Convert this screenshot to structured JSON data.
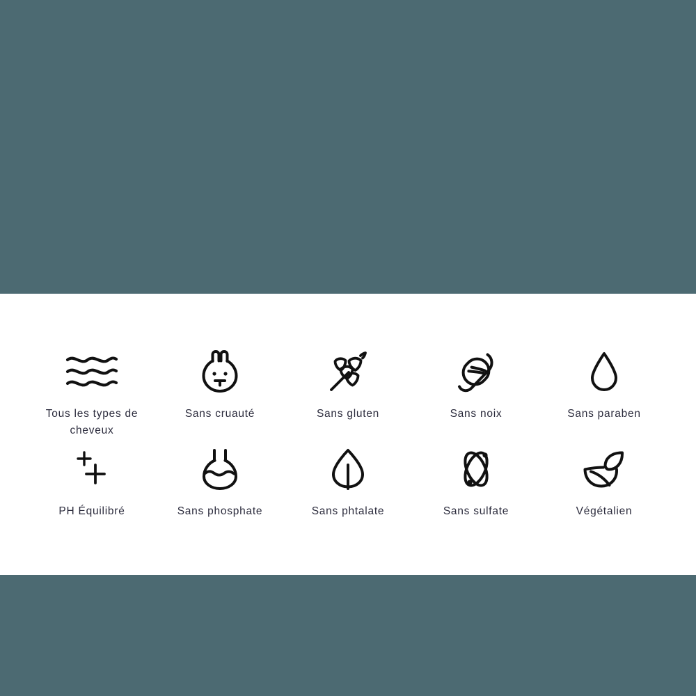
{
  "theme": {
    "band_color": "#4c6a72",
    "section_background": "#ffffff",
    "label_color": "#2b2b3c",
    "icon_color": "#111111"
  },
  "features_section": {
    "rows": [
      {
        "items": [
          {
            "icon": "wavy-lines-icon",
            "label": "Tous les types de cheveux"
          },
          {
            "icon": "rabbit-head-icon",
            "label": "Sans cruauté"
          },
          {
            "icon": "wheat-stalk-icon",
            "label": "Sans gluten"
          },
          {
            "icon": "peanut-icon",
            "label": "Sans noix"
          },
          {
            "icon": "water-droplet-icon",
            "label": "Sans paraben"
          }
        ]
      },
      {
        "items": [
          {
            "icon": "double-plus-icon",
            "label": "PH Équilibré"
          },
          {
            "icon": "flask-icon",
            "label": "Sans phosphate"
          },
          {
            "icon": "leaf-stem-icon",
            "label": "Sans phtalate"
          },
          {
            "icon": "atom-icon",
            "label": "Sans sulfate"
          },
          {
            "icon": "two-leaves-icon",
            "label": "Végétalien"
          }
        ]
      }
    ]
  }
}
